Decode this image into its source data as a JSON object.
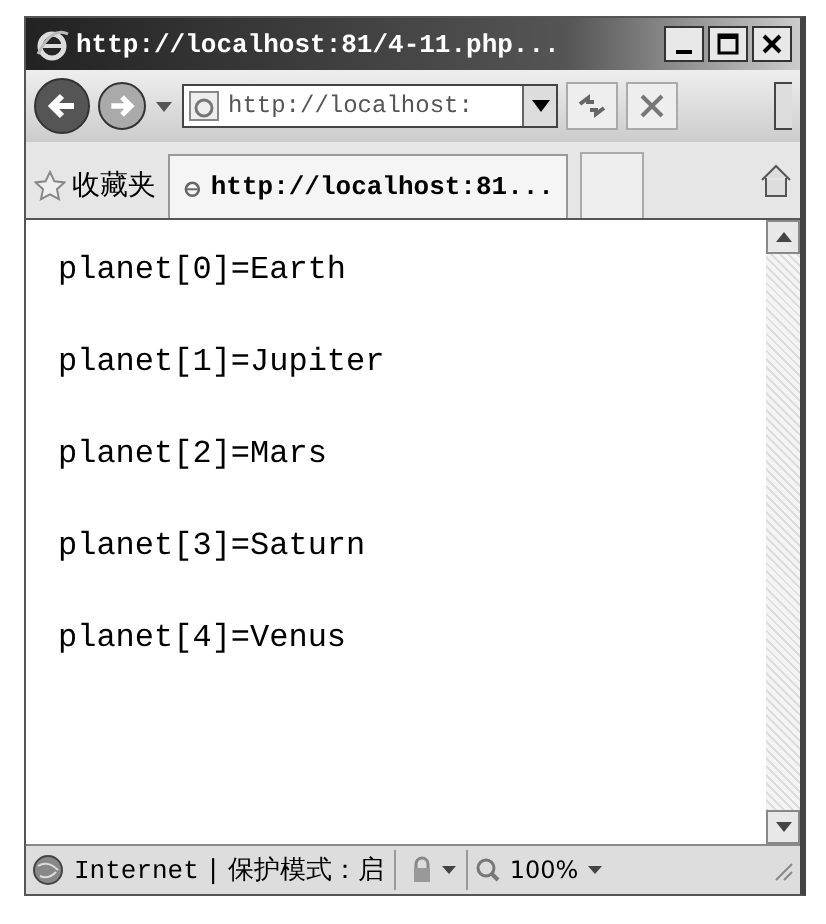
{
  "window": {
    "title": "http://localhost:81/4-11.php..."
  },
  "address_bar": {
    "value": "http://localhost:"
  },
  "favorites_bar": {
    "label": "收藏夹"
  },
  "tabs": [
    {
      "label": "http://localhost:81...",
      "selected": true
    }
  ],
  "content": {
    "lines": [
      "planet[0]=Earth",
      "planet[1]=Jupiter",
      "planet[2]=Mars",
      "planet[3]=Saturn",
      "planet[4]=Venus"
    ]
  },
  "status_bar": {
    "zone": "Internet",
    "separator": "|",
    "protected_mode": "保护模式：启",
    "zoom": "100%"
  }
}
